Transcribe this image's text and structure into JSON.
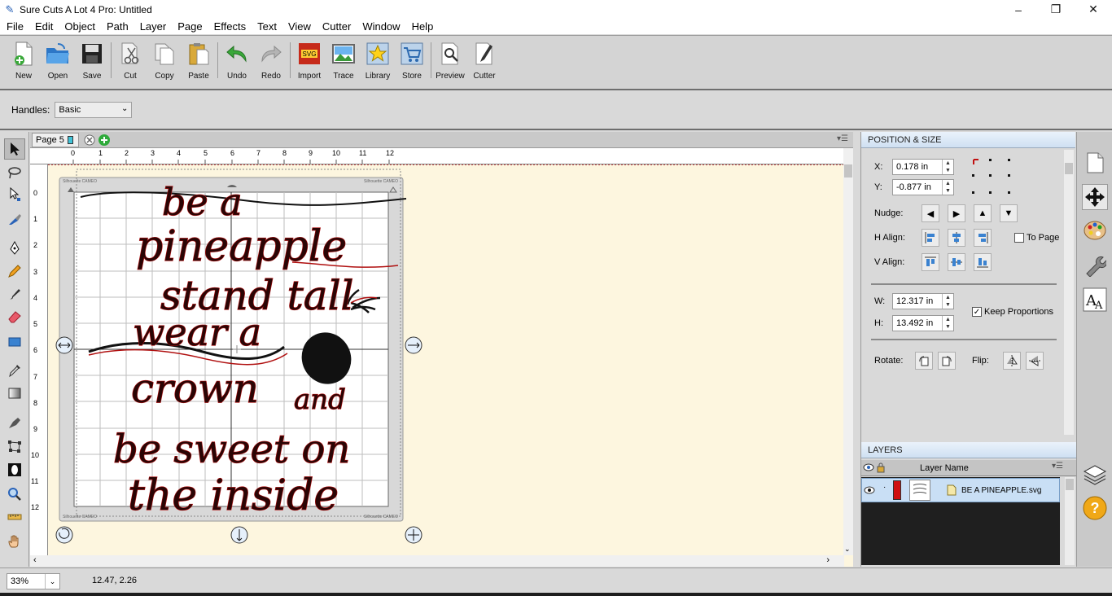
{
  "window": {
    "title": "Sure Cuts A Lot 4 Pro: Untitled"
  },
  "menu": [
    "File",
    "Edit",
    "Object",
    "Path",
    "Layer",
    "Page",
    "Effects",
    "Text",
    "View",
    "Cutter",
    "Window",
    "Help"
  ],
  "toolbar": {
    "new": "New",
    "open": "Open",
    "save": "Save",
    "cut": "Cut",
    "copy": "Copy",
    "paste": "Paste",
    "undo": "Undo",
    "redo": "Redo",
    "import": "Import",
    "trace": "Trace",
    "library": "Library",
    "store": "Store",
    "preview": "Preview",
    "cutter": "Cutter"
  },
  "handles": {
    "label": "Handles:",
    "value": "Basic"
  },
  "page_tab": {
    "label": "Page 5"
  },
  "ruler": {
    "h_ticks": [
      "0",
      "1",
      "2",
      "3",
      "4",
      "5",
      "6",
      "7",
      "8",
      "9",
      "10",
      "11",
      "12"
    ],
    "v_ticks": [
      "0",
      "1",
      "2",
      "3",
      "4",
      "5",
      "6",
      "7",
      "8",
      "9",
      "10",
      "11",
      "12"
    ]
  },
  "mat": {
    "brand_label": "Silhouette CAMEO"
  },
  "design_text": {
    "line1": "be   a",
    "line2": "pineapple",
    "line3": "stand tall",
    "line4": "wear  a",
    "line5": "crown",
    "line6": "and",
    "line7": "be sweet on",
    "line8": "the inside"
  },
  "position_size": {
    "title": "POSITION & SIZE",
    "x_label": "X:",
    "x_value": "0.178 in",
    "y_label": "Y:",
    "y_value": "-0.877 in",
    "nudge_label": "Nudge:",
    "halign_label": "H Align:",
    "valign_label": "V Align:",
    "to_page_label": "To Page",
    "w_label": "W:",
    "w_value": "12.317 in",
    "h_label": "H:",
    "h_value": "13.492 in",
    "keep_proportions_label": "Keep Proportions",
    "rotate_label": "Rotate:",
    "flip_label": "Flip:"
  },
  "layers": {
    "title": "LAYERS",
    "column_header": "Layer Name",
    "rows": [
      {
        "name": "BE A PINEAPPLE.svg",
        "color": "#d01010"
      }
    ]
  },
  "status": {
    "zoom": "33%",
    "coords": "12.47, 2.26"
  },
  "colors": {
    "accent": "#2a63b8",
    "layer_color": "#d01010",
    "canvas_bg": "#fdf6df"
  }
}
